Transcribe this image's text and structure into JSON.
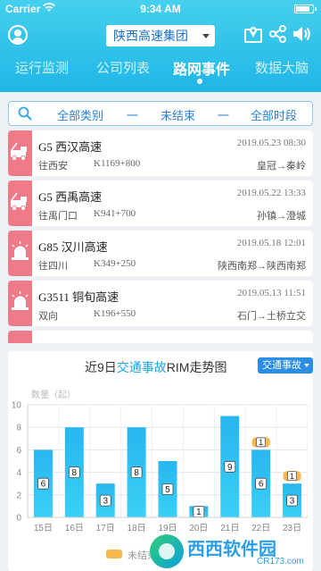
{
  "status_bar": {
    "carrier": "Carrier",
    "time": "9:34 AM"
  },
  "header": {
    "org_select": "陕西高速集团",
    "tabs": [
      {
        "label": "运行监测",
        "active": false
      },
      {
        "label": "公司列表",
        "active": false
      },
      {
        "label": "路网事件",
        "active": true
      },
      {
        "label": "数据大脑",
        "active": false
      }
    ]
  },
  "filter": {
    "category": "全部类别",
    "sep": "一",
    "status": "未结束",
    "period": "全部时段"
  },
  "events": [
    {
      "icon": "tow-truck-icon",
      "title": "G5 西汉高速",
      "time": "2019.05.23 08:30",
      "direction": "往西安",
      "km": "K1169+800",
      "route": "皇冠→秦岭"
    },
    {
      "icon": "tow-truck-icon",
      "title": "G5 西禹高速",
      "time": "2019.05.22 13:33",
      "direction": "往禹门口",
      "km": "K941+700",
      "route": "孙镇→澄城"
    },
    {
      "icon": "siren-icon",
      "title": "G85 汉川高速",
      "time": "2019.05.18 12:01",
      "direction": "往四川",
      "km": "K349+250",
      "route": "陕西南郑→陕西南郑"
    },
    {
      "icon": "siren-icon",
      "title": "G3511 铜旬高速",
      "time": "2019.05.13 11:51",
      "direction": "双向",
      "km": "K196+550",
      "route": "石门→土桥立交"
    },
    {
      "icon": "siren-icon",
      "title": "",
      "time": "",
      "direction": "",
      "km": "",
      "route": ""
    }
  ],
  "chart": {
    "title_prefix": "近9日",
    "title_highlight": "交通事故",
    "title_suffix": "RIM走势图",
    "dropdown": "交通事故",
    "legend_label": "未结束"
  },
  "chart_data": {
    "type": "bar",
    "title": "近9日交通事故RIM走势图",
    "ylabel": "数量（起）",
    "ylim": [
      0,
      10
    ],
    "yticks": [
      0,
      2,
      4,
      6,
      8,
      10
    ],
    "categories": [
      "15日",
      "16日",
      "17日",
      "18日",
      "19日",
      "20日",
      "21日",
      "22日",
      "23日"
    ],
    "series": [
      {
        "values": [
          6,
          8,
          3,
          8,
          5,
          1,
          9,
          6,
          3
        ]
      },
      {
        "name": "未结束",
        "values": [
          0,
          0,
          0,
          0,
          0,
          0,
          0,
          1,
          1
        ]
      }
    ],
    "grid": true
  },
  "watermark": {
    "text": "西西软件园",
    "url": "CR173.com"
  },
  "colors": {
    "header": "#2cc0ea",
    "accent": "#1aa4e8",
    "bar_top": "#27b6ef",
    "bar_bottom": "#3ad0f5",
    "legend": "#f7b84f",
    "badge": "#f07a88"
  }
}
